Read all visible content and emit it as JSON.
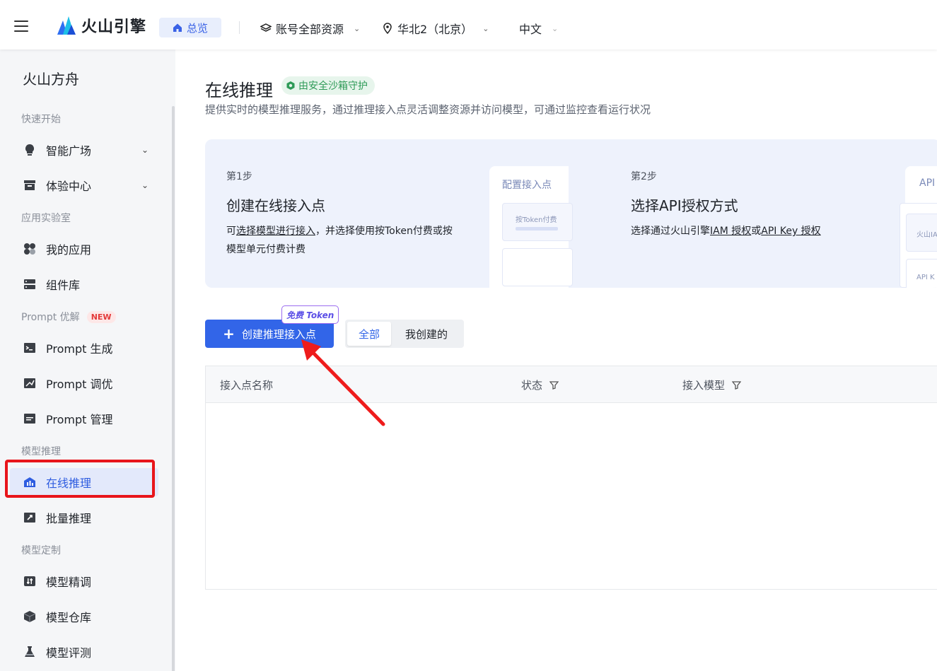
{
  "topbar": {
    "brand": "火山引擎",
    "overview": "总览",
    "account_scope": "账号全部资源",
    "region": "华北2（北京）",
    "language": "中文"
  },
  "sidebar": {
    "title": "火山方舟",
    "sections": {
      "quick_start": "快速开始",
      "app_lab": "应用实验室",
      "prompt": "Prompt 优解",
      "prompt_badge": "NEW",
      "model_inference": "模型推理",
      "model_custom": "模型定制"
    },
    "items": {
      "smart_square": "智能广场",
      "experience_center": "体验中心",
      "my_apps": "我的应用",
      "components": "组件库",
      "prompt_generate": "Prompt 生成",
      "prompt_tune": "Prompt 调优",
      "prompt_manage": "Prompt 管理",
      "online_inference": "在线推理",
      "batch_inference": "批量推理",
      "fine_tune": "模型精调",
      "model_repo": "模型仓库",
      "model_eval": "模型评测"
    }
  },
  "main": {
    "title": "在线推理",
    "safe_badge": "由安全沙箱守护",
    "description": "提供实时的模型推理服务，通过推理接入点灵活调整资源并访问模型，可通过监控查看运行状况",
    "guide": {
      "step1_no": "第1步",
      "step1_title": "创建在线接入点",
      "step1_desc_pre": "可",
      "step1_desc_link": "选择模型进行接入",
      "step1_desc_post": "，并选择使用按Token付费或按",
      "step1_desc_line2": "模型单元付费计费",
      "mock1_label": "配置接入点",
      "mock1_card": "按Token付费",
      "step2_no": "第2步",
      "step2_title": "选择API授权方式",
      "step2_desc_pre": "选择通过火山引擎",
      "step2_link1": "IAM 授权",
      "step2_or": "或",
      "step2_link2": "API Key 授权",
      "mock2_label": "API",
      "mock2_card1": "火山IA",
      "mock2_card2": "API K"
    },
    "create_button": "创建推理接入点",
    "free_tag": "免费 Token",
    "filter_all": "全部",
    "filter_mine": "我创建的",
    "table_headers": {
      "name": "接入点名称",
      "status": "状态",
      "model": "接入模型"
    }
  }
}
